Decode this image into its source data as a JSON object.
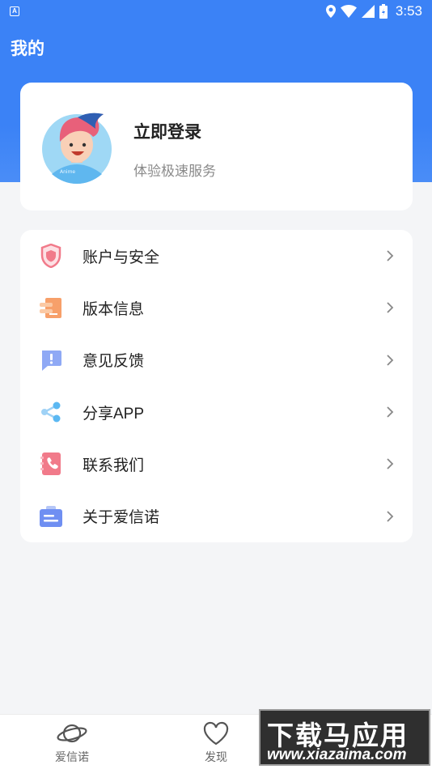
{
  "statusbar": {
    "app_badge": "A",
    "time": "3:53"
  },
  "header": {
    "title": "我的"
  },
  "profile": {
    "login_title": "立即登录",
    "login_subtitle": "体验极速服务",
    "avatar_caption": "Anime"
  },
  "menu": {
    "items": [
      {
        "label": "账户与安全",
        "icon": "shield-icon",
        "color": "#f17a8a"
      },
      {
        "label": "版本信息",
        "icon": "document-icon",
        "color": "#f7a06a"
      },
      {
        "label": "意见反馈",
        "icon": "feedback-icon",
        "color": "#6f8ff2"
      },
      {
        "label": "分享APP",
        "icon": "share-icon",
        "color": "#5bb8f2"
      },
      {
        "label": "联系我们",
        "icon": "phone-book-icon",
        "color": "#f17a8a"
      },
      {
        "label": "关于爱信诺",
        "icon": "briefcase-icon",
        "color": "#6f8ff2"
      }
    ]
  },
  "tabbar": {
    "tabs": [
      {
        "label": "爱信诺",
        "icon": "planet-icon"
      },
      {
        "label": "发现",
        "icon": "heart-icon"
      }
    ]
  },
  "watermark": {
    "line1": "下载马应用",
    "line2": "www.xiazaima.com"
  },
  "colors": {
    "primary": "#3b82f6",
    "background": "#f4f5f7"
  }
}
